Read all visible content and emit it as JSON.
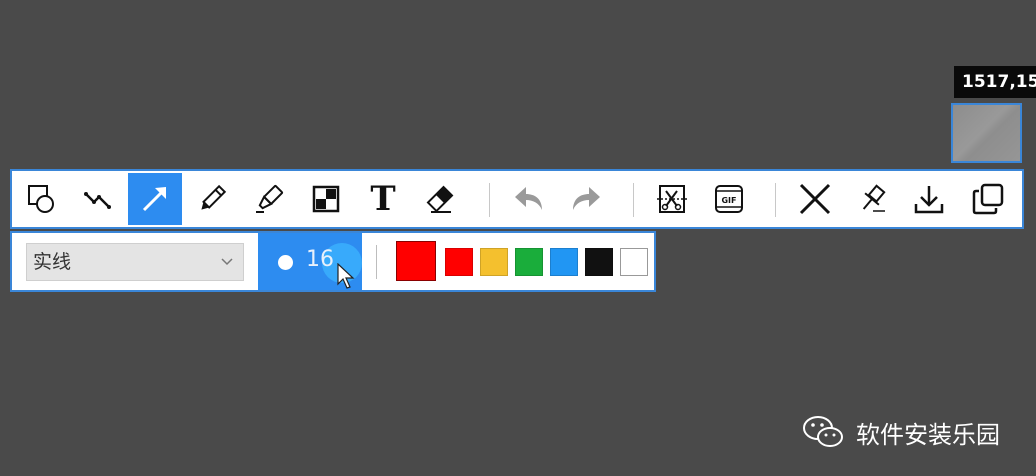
{
  "coordinate_readout": "1517,15",
  "toolbar": {
    "tools": [
      {
        "name": "shape",
        "icon": "shape-icon",
        "active": false
      },
      {
        "name": "polyline",
        "icon": "polyline-icon",
        "active": false
      },
      {
        "name": "arrow",
        "icon": "arrow-icon",
        "active": true
      },
      {
        "name": "pencil",
        "icon": "pencil-icon",
        "active": false
      },
      {
        "name": "highlighter",
        "icon": "highlighter-icon",
        "active": false
      },
      {
        "name": "mosaic",
        "icon": "mosaic-icon",
        "active": false
      },
      {
        "name": "text",
        "icon": "text-icon",
        "label": "T",
        "active": false
      },
      {
        "name": "eraser",
        "icon": "eraser-icon",
        "active": false
      },
      {
        "name": "undo",
        "icon": "undo-icon",
        "active": false
      },
      {
        "name": "redo",
        "icon": "redo-icon",
        "active": false
      },
      {
        "name": "screenshot-cut",
        "icon": "scissors-icon",
        "active": false
      },
      {
        "name": "gif",
        "icon": "gif-icon",
        "label": "GIF",
        "active": false
      },
      {
        "name": "close",
        "icon": "close-icon",
        "active": false
      },
      {
        "name": "pin",
        "icon": "pin-icon",
        "active": false
      },
      {
        "name": "download",
        "icon": "download-icon",
        "active": false
      },
      {
        "name": "copy",
        "icon": "copy-icon",
        "active": false
      }
    ]
  },
  "subbar": {
    "line_style": "实线",
    "pen_size": "16",
    "colors": [
      "#ff0000",
      "#ff0000",
      "#f4c02e",
      "#1aad3b",
      "#2196f3",
      "#111111",
      "#ffffff"
    ],
    "selected_color": "#ff0000"
  },
  "theme": {
    "accent": "#2d8cf0",
    "border": "#3a86d8"
  },
  "watermark": {
    "text": "软件安装乐园"
  }
}
